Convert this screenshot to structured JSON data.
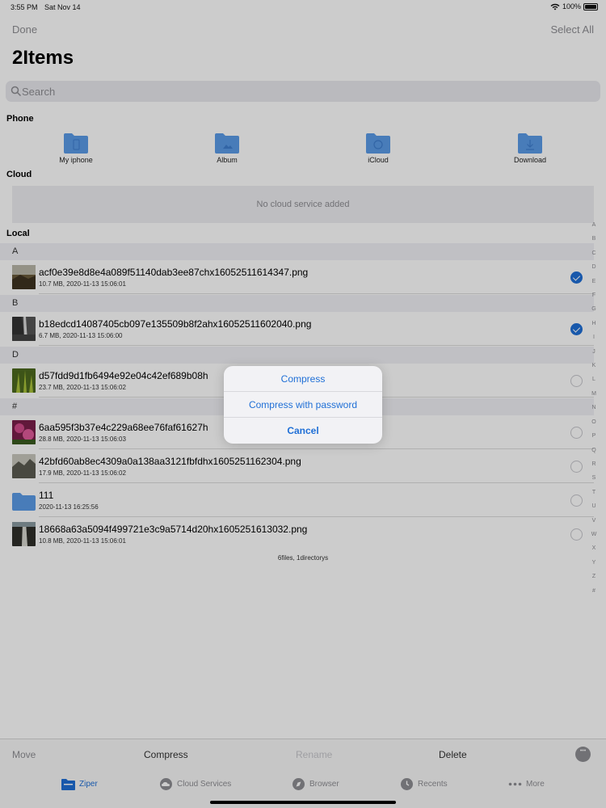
{
  "status_bar": {
    "time": "3:55 PM",
    "date": "Sat Nov 14",
    "battery": "100%"
  },
  "nav": {
    "done_label": "Done",
    "select_all_label": "Select All",
    "title": "2Items"
  },
  "search": {
    "placeholder": "Search"
  },
  "phone": {
    "label": "Phone",
    "items": [
      {
        "label": "My iphone",
        "icon": "phone-folder-icon"
      },
      {
        "label": "Album",
        "icon": "image-folder-icon"
      },
      {
        "label": "iCloud",
        "icon": "cloud-folder-icon"
      },
      {
        "label": "Download",
        "icon": "download-folder-icon"
      }
    ]
  },
  "cloud": {
    "label": "Cloud",
    "empty_text": "No cloud service added"
  },
  "local": {
    "label": "Local",
    "sections": [
      {
        "header": "A",
        "files": [
          {
            "name": "acf0e39e8d8e4a089f51140dab3ee87chx16052511614347.png",
            "meta": "10.7 MB, 2020-11-13 15:06:01",
            "selected": true
          }
        ]
      },
      {
        "header": "B",
        "files": [
          {
            "name": "b18edcd14087405cb097e135509b8f2ahx16052511602040.png",
            "meta": "6.7 MB, 2020-11-13 15:06:00",
            "selected": true
          }
        ]
      },
      {
        "header": "D",
        "files": [
          {
            "name": "d57fdd9d1fb6494e92e04c42ef689b08h",
            "meta": "23.7 MB, 2020-11-13 15:06:02",
            "selected": false
          }
        ]
      },
      {
        "header": "#",
        "files": [
          {
            "name": "6aa595f3b37e4c229a68ee76faf61627h",
            "meta": "28.8 MB, 2020-11-13 15:06:03",
            "selected": false
          },
          {
            "name": "42bfd60ab8ec4309a0a138aa3121fbfdhx1605251162304.png",
            "meta": "17.9 MB, 2020-11-13 15:06:02",
            "selected": false
          },
          {
            "name": "111",
            "meta": "2020-11-13 16:25:56",
            "selected": false
          },
          {
            "name": "18668a63a5094f499721e3c9a5714d20hx1605251613032.png",
            "meta": "10.8 MB, 2020-11-13 15:06:01",
            "selected": false
          }
        ]
      }
    ],
    "summary": "6files, 1directorys"
  },
  "index_letters": [
    "A",
    "B",
    "C",
    "D",
    "E",
    "F",
    "G",
    "H",
    "I",
    "J",
    "K",
    "L",
    "M",
    "N",
    "O",
    "P",
    "Q",
    "R",
    "S",
    "T",
    "U",
    "V",
    "W",
    "X",
    "Y",
    "Z",
    "#"
  ],
  "action_bar": {
    "move": "Move",
    "compress": "Compress",
    "rename": "Rename",
    "delete": "Delete"
  },
  "tab_bar": {
    "items": [
      {
        "label": "Ziper",
        "icon": "folder-icon"
      },
      {
        "label": "Cloud Services",
        "icon": "cloud-icon"
      },
      {
        "label": "Browser",
        "icon": "compass-icon"
      },
      {
        "label": "Recents",
        "icon": "clock-icon"
      },
      {
        "label": "More",
        "icon": "more-icon"
      }
    ]
  },
  "dialog": {
    "compress": "Compress",
    "compress_password": "Compress with password",
    "cancel": "Cancel"
  },
  "colors": {
    "accent": "#1f6fd6",
    "folder": "#5b9be8",
    "muted": "#8e8e93"
  }
}
